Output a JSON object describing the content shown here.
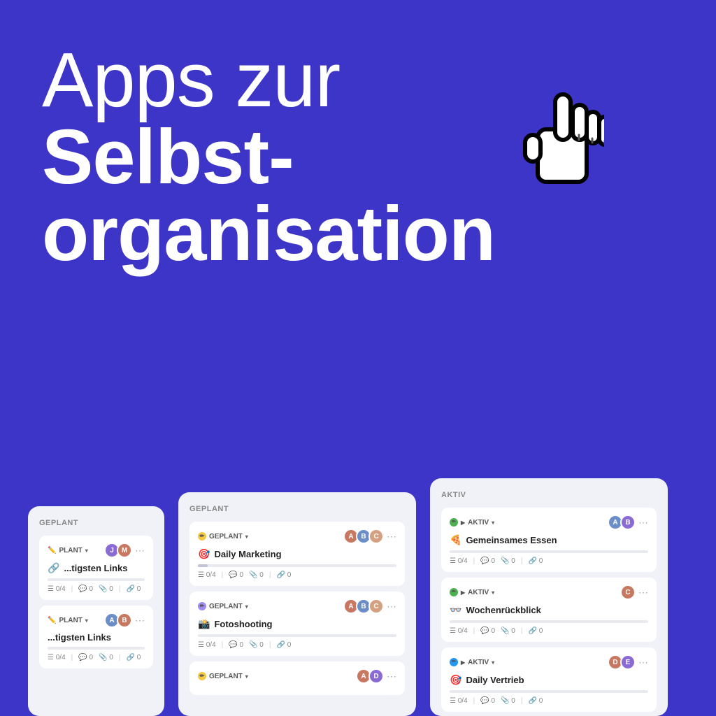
{
  "hero": {
    "line1": "Apps zur",
    "line2": "Selbst-",
    "line3": "organisation"
  },
  "left_card": {
    "header": "GEPLANT",
    "items": [
      {
        "status": "GEPLANT",
        "status_color": "yellow",
        "title": "...tigsten Links",
        "emoji": "🔗",
        "progress": 0,
        "meta_tasks": "0/4",
        "meta_comments": "0",
        "meta_attachments": "0",
        "meta_links": "0",
        "avatars": [
          "#8a6ad4",
          "#c87860"
        ]
      }
    ]
  },
  "middle_card": {
    "header": "GEPLANT",
    "items": [
      {
        "status": "GEPLANT",
        "status_color": "yellow",
        "title": "Daily Marketing",
        "emoji": "🎯",
        "progress": 0,
        "meta_tasks": "0/4",
        "meta_comments": "0",
        "meta_attachments": "0",
        "meta_links": "0",
        "avatars": [
          "#c87860",
          "#6b8ec8",
          "#d4a080"
        ]
      },
      {
        "status": "GEPLANT",
        "status_color": "purple",
        "title": "Fotoshooting",
        "emoji": "📸",
        "progress": 0,
        "meta_tasks": "0/4",
        "meta_comments": "0",
        "meta_attachments": "0",
        "meta_links": "0",
        "avatars": [
          "#c87860",
          "#6b8ec8",
          "#d4a080"
        ]
      },
      {
        "status": "GEPLANT",
        "status_color": "yellow",
        "title": "",
        "emoji": "",
        "progress": 0,
        "meta_tasks": "0/4",
        "meta_comments": "0",
        "meta_attachments": "0",
        "meta_links": "0",
        "avatars": [
          "#c87860",
          "#8a6ad4"
        ]
      }
    ]
  },
  "right_card": {
    "header": "AKTIV",
    "items": [
      {
        "status": "AKTIV",
        "status_color": "green",
        "title": "Gemeinsames Essen",
        "emoji": "🍕",
        "progress": 0,
        "meta_tasks": "0/4",
        "meta_comments": "0",
        "meta_attachments": "0",
        "meta_links": "0",
        "avatars": [
          "#6b8ec8",
          "#8a6ad4"
        ]
      },
      {
        "status": "AKTIV",
        "status_color": "green",
        "title": "Wochenrückblick",
        "emoji": "👓",
        "progress": 0,
        "meta_tasks": "0/4",
        "meta_comments": "0",
        "meta_attachments": "0",
        "meta_links": "0",
        "avatars": [
          "#c87860"
        ]
      },
      {
        "status": "AKTIV",
        "status_color": "blue",
        "title": "Daily Vertrieb",
        "emoji": "🎯",
        "progress": 0,
        "meta_tasks": "0/4",
        "meta_comments": "0",
        "meta_attachments": "0",
        "meta_links": "0",
        "avatars": [
          "#c87860",
          "#8a6ad4"
        ]
      }
    ]
  }
}
